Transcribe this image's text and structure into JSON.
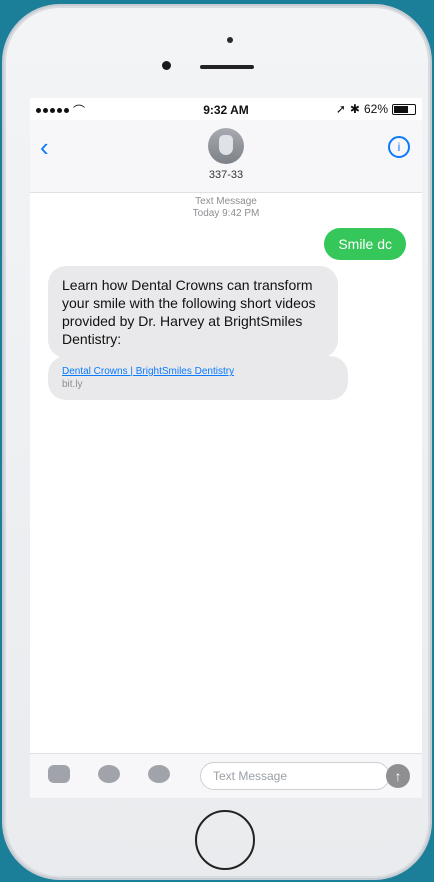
{
  "status": {
    "time": "9:32 AM",
    "battery": "62%"
  },
  "header": {
    "contact": "337-33"
  },
  "timestamp": {
    "line1": "Text Message",
    "line2": "Today 9:42 PM"
  },
  "messages": {
    "outgoing": "Smile dc",
    "incoming": "Learn how Dental Crowns can transform your smile with the following short videos provided by Dr. Harvey at BrightSmiles Dentistry:",
    "link_title": "Dental Crowns | BrightSmiles Dentistry",
    "link_domain": "bit.ly"
  },
  "composer": {
    "placeholder": "Text Message"
  },
  "icons": {
    "back": "chevron-left-icon",
    "info": "info-icon",
    "camera": "camera-icon",
    "digital_touch": "heart-icon",
    "app_store": "app-store-icon",
    "send": "send-icon"
  },
  "colors": {
    "ios_blue": "#0a7aff",
    "sms_green": "#35c759",
    "incoming_bubble": "#e9e9eb",
    "frame_bg": "#1b7f9a"
  }
}
